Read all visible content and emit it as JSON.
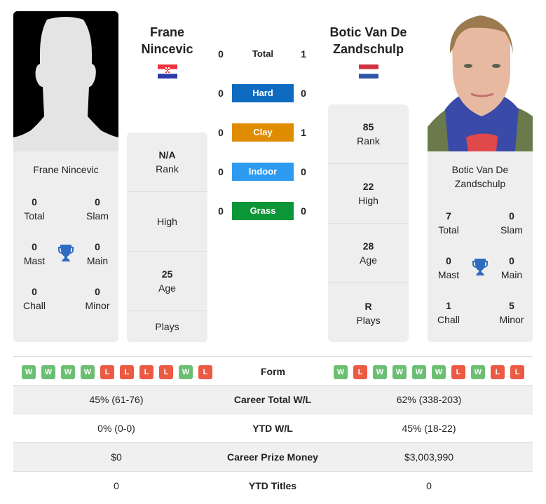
{
  "player1": {
    "name": "Frane Nincevic",
    "header_line1": "Frane",
    "header_line2": "Nincevic",
    "flag": "croatia-flag",
    "photo": "silhouette-placeholder",
    "titles": {
      "total": {
        "value": "0",
        "label": "Total"
      },
      "slam": {
        "value": "0",
        "label": "Slam"
      },
      "mast": {
        "value": "0",
        "label": "Mast"
      },
      "main": {
        "value": "0",
        "label": "Main"
      },
      "chall": {
        "value": "0",
        "label": "Chall"
      },
      "minor": {
        "value": "0",
        "label": "Minor"
      }
    },
    "stats": {
      "rank": {
        "value": "N/A",
        "label": "Rank"
      },
      "high": {
        "value": "",
        "label": "High"
      },
      "age": {
        "value": "25",
        "label": "Age"
      },
      "plays": {
        "value": "",
        "label": "Plays"
      }
    },
    "form": [
      "W",
      "W",
      "W",
      "W",
      "L",
      "L",
      "L",
      "L",
      "W",
      "L"
    ]
  },
  "player2": {
    "name_line1": "Botic Van De",
    "name_line2": "Zandschulp",
    "header_line1": "Botic Van De",
    "header_line2": "Zandschulp",
    "flag": "netherlands-flag",
    "photo": "player-photo",
    "titles": {
      "total": {
        "value": "7",
        "label": "Total"
      },
      "slam": {
        "value": "0",
        "label": "Slam"
      },
      "mast": {
        "value": "0",
        "label": "Mast"
      },
      "main": {
        "value": "0",
        "label": "Main"
      },
      "chall": {
        "value": "1",
        "label": "Chall"
      },
      "minor": {
        "value": "5",
        "label": "Minor"
      }
    },
    "stats": {
      "rank": {
        "value": "85",
        "label": "Rank"
      },
      "high": {
        "value": "22",
        "label": "High"
      },
      "age": {
        "value": "28",
        "label": "Age"
      },
      "plays": {
        "value": "R",
        "label": "Plays"
      }
    },
    "form": [
      "W",
      "L",
      "W",
      "W",
      "W",
      "W",
      "L",
      "W",
      "L",
      "L"
    ]
  },
  "h2h": [
    {
      "label": "Total",
      "left": "0",
      "right": "1",
      "color": ""
    },
    {
      "label": "Hard",
      "left": "0",
      "right": "0",
      "color": "#0f6bbf"
    },
    {
      "label": "Clay",
      "left": "0",
      "right": "1",
      "color": "#e08c00"
    },
    {
      "label": "Indoor",
      "left": "0",
      "right": "0",
      "color": "#2e9bf0"
    },
    {
      "label": "Grass",
      "left": "0",
      "right": "0",
      "color": "#0d9637"
    }
  ],
  "form_label": "Form",
  "form_colors": {
    "W": "#6cbf72",
    "L": "#ec5a43"
  },
  "comparison": [
    {
      "label": "Career Total W/L",
      "left": "45% (61-76)",
      "right": "62% (338-203)"
    },
    {
      "label": "YTD W/L",
      "left": "0% (0-0)",
      "right": "45% (18-22)"
    },
    {
      "label": "Career Prize Money",
      "left": "$0",
      "right": "$3,003,990"
    },
    {
      "label": "YTD Titles",
      "left": "0",
      "right": "0"
    }
  ],
  "accent_trophy_color": "#2f6cc0"
}
